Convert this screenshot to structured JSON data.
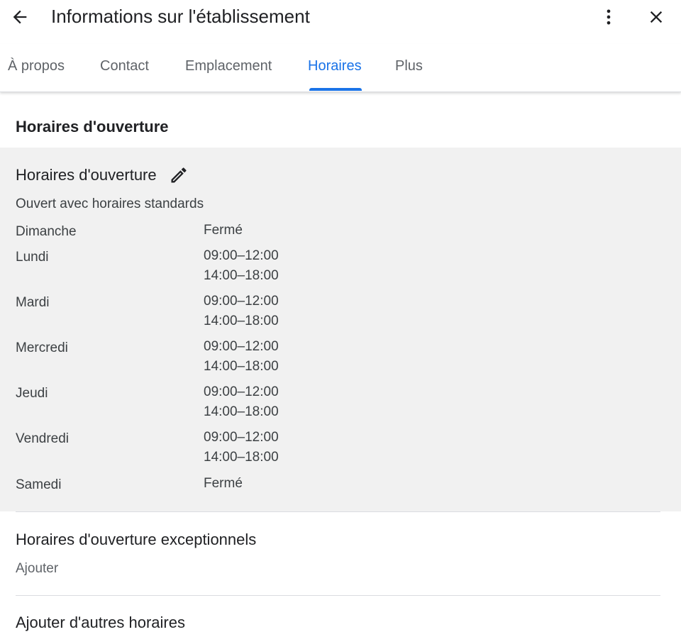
{
  "header": {
    "title": "Informations sur l'établissement",
    "icons": {
      "back": "arrow-back-icon",
      "more": "more-vert-icon",
      "close": "close-icon"
    }
  },
  "tabs": [
    {
      "label": "À propos",
      "active": false
    },
    {
      "label": "Contact",
      "active": false
    },
    {
      "label": "Emplacement",
      "active": false
    },
    {
      "label": "Horaires",
      "active": true
    },
    {
      "label": "Plus",
      "active": false
    }
  ],
  "colors": {
    "accent": "#1a73e8",
    "panel_bg": "#f1f1f1",
    "text": "#202124",
    "muted": "#5f6368"
  },
  "section_title": "Horaires d'ouverture",
  "hours_panel": {
    "heading": "Horaires d'ouverture",
    "edit_icon": "pencil-icon",
    "status": "Ouvert avec horaires standards",
    "days": [
      {
        "day": "Dimanche",
        "hours": [
          "Fermé"
        ]
      },
      {
        "day": "Lundi",
        "hours": [
          "09:00–12:00",
          "14:00–18:00"
        ]
      },
      {
        "day": "Mardi",
        "hours": [
          "09:00–12:00",
          "14:00–18:00"
        ]
      },
      {
        "day": "Mercredi",
        "hours": [
          "09:00–12:00",
          "14:00–18:00"
        ]
      },
      {
        "day": "Jeudi",
        "hours": [
          "09:00–12:00",
          "14:00–18:00"
        ]
      },
      {
        "day": "Vendredi",
        "hours": [
          "09:00–12:00",
          "14:00–18:00"
        ]
      },
      {
        "day": "Samedi",
        "hours": [
          "Fermé"
        ]
      }
    ]
  },
  "special_hours": {
    "title": "Horaires d'ouverture exceptionnels",
    "add_label": "Ajouter"
  },
  "more_hours": {
    "title": "Ajouter d'autres horaires"
  }
}
